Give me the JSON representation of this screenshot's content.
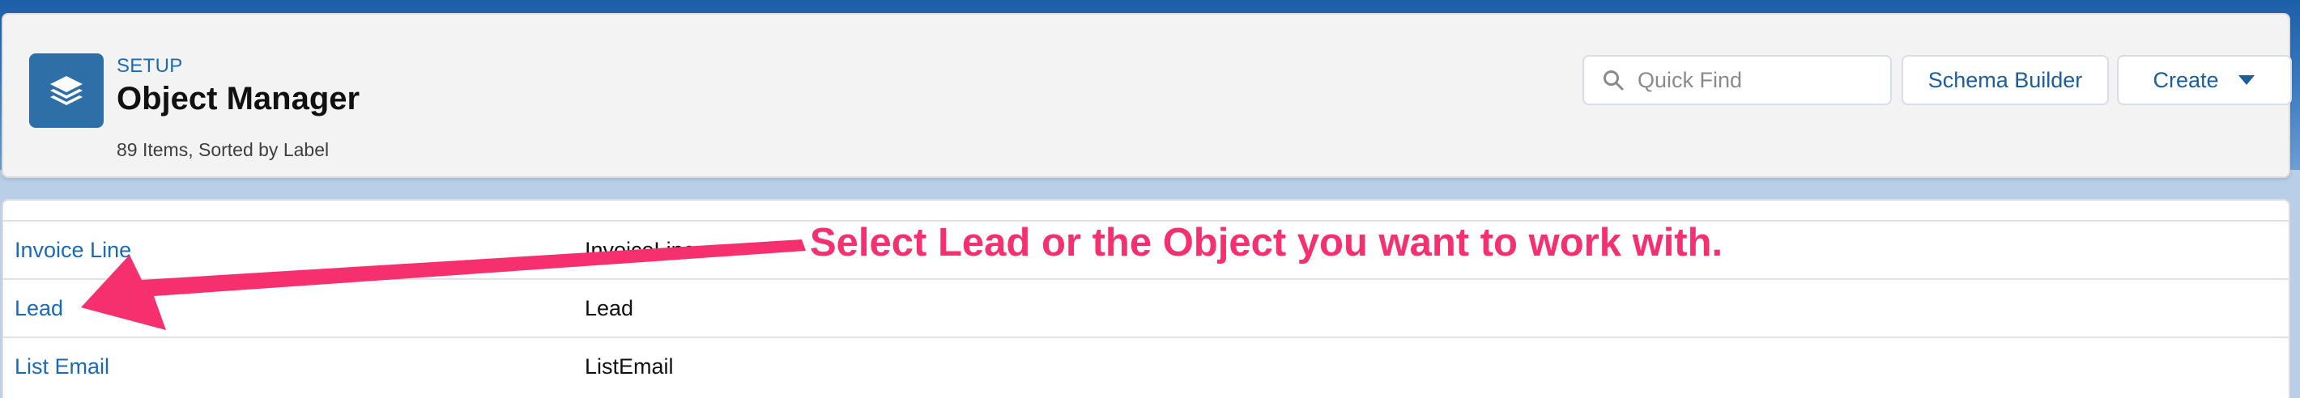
{
  "header": {
    "eyebrow": "SETUP",
    "title": "Object Manager",
    "subtitle": "89 Items, Sorted by Label",
    "app_icon": "layers-icon"
  },
  "toolbar": {
    "search_placeholder": "Quick Find",
    "search_value": "",
    "search_icon": "search-icon",
    "schema_builder_label": "Schema Builder",
    "create_label": "Create",
    "create_icon": "caret-down-icon"
  },
  "rows": [
    {
      "label": "Invoice Line",
      "api_name": "InvoiceLine"
    },
    {
      "label": "Lead",
      "api_name": "Lead"
    },
    {
      "label": "List Email",
      "api_name": "ListEmail"
    }
  ],
  "annotation": {
    "text": "Select Lead or the Object you want to work with.",
    "color": "#f6306f"
  },
  "colors": {
    "brand_blue": "#2f6fa7",
    "link_blue": "#1b6ab5"
  }
}
